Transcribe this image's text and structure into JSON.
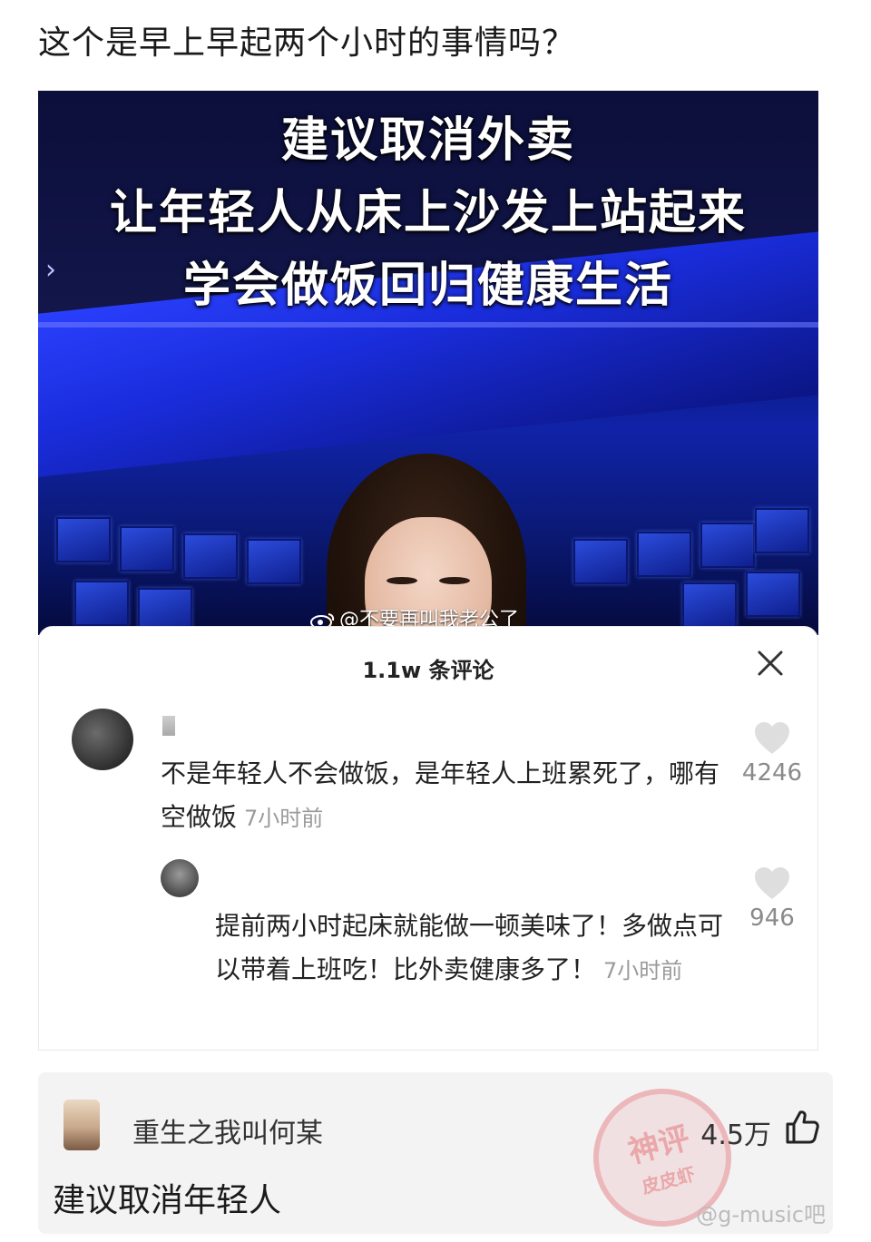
{
  "post": {
    "question": "这个是早上早起两个小时的事情吗？"
  },
  "news_image": {
    "headline_lines": [
      "建议取消外卖",
      "让年轻人从床上沙发上站起来",
      "学会做饭回归健康生活"
    ],
    "watermark": "@不要再叫我老公了"
  },
  "comments_sheet": {
    "count_label": "1.1w 条评论",
    "comments": [
      {
        "text": "不是年轻人不会做饭，是年轻人上班累死了，哪有空做饭",
        "time": "7小时前",
        "likes": "4246"
      },
      {
        "text": "提前两小时起床就能做一顿美味了！多做点可以带着上班吃！比外卖健康多了！",
        "time": "7小时前",
        "likes": "946"
      }
    ]
  },
  "reply": {
    "username": "重生之我叫何某",
    "likes": "4.5万",
    "text": "建议取消年轻人",
    "stamp_text": [
      "神评",
      "皮皮虾"
    ],
    "site_mark": "@g-music吧"
  },
  "colors": {
    "news_blue": "#1023a8",
    "headline_text": "#ffffff",
    "muted_gray": "#9a9a9a"
  }
}
